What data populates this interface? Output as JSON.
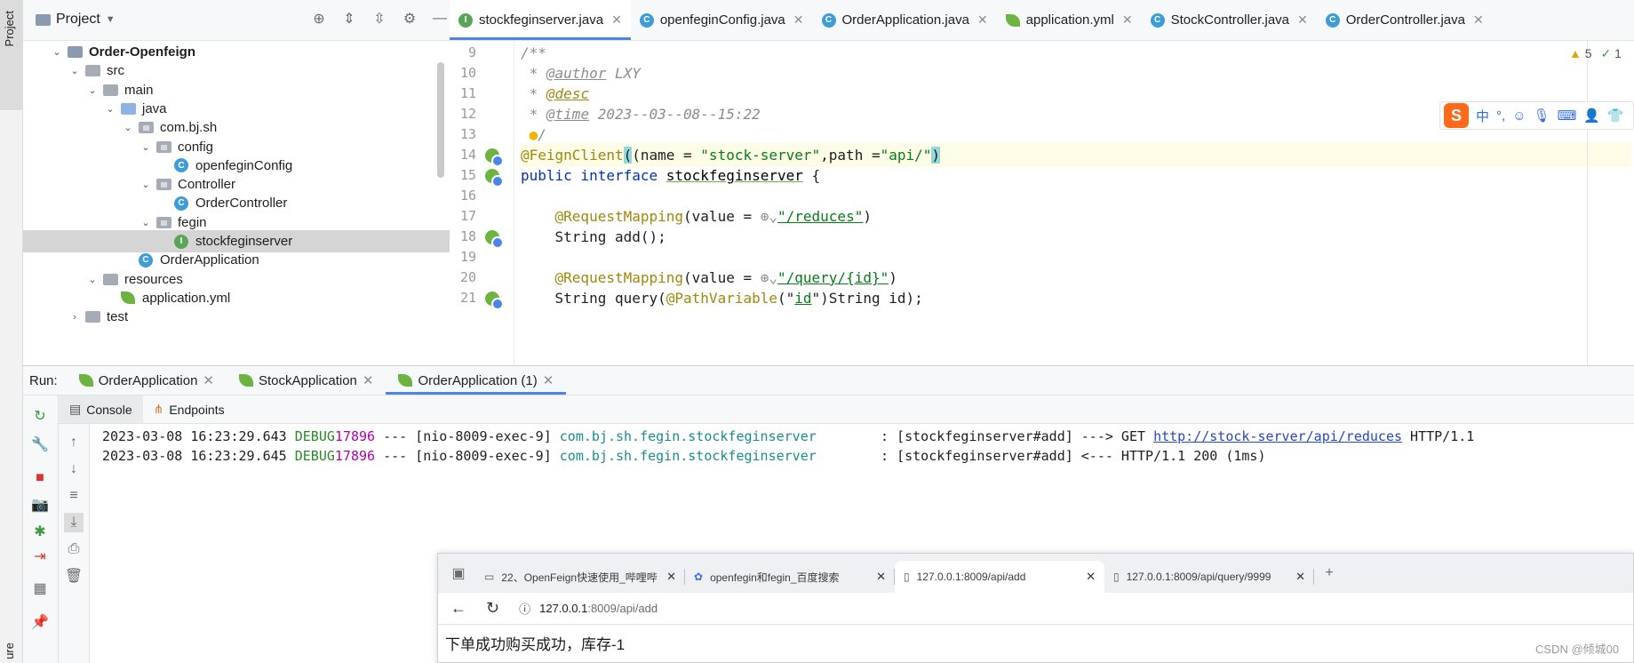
{
  "left_strip": {
    "project_tab": "Project",
    "structure_tab": "ure"
  },
  "project_panel": {
    "title": "Project"
  },
  "project_tree": [
    {
      "label": "Order-Openfeign",
      "kind": "module",
      "bold": true
    },
    {
      "label": "src",
      "kind": "folder"
    },
    {
      "label": "main",
      "kind": "folder"
    },
    {
      "label": "java",
      "kind": "folder-blue"
    },
    {
      "label": "com.bj.sh",
      "kind": "package"
    },
    {
      "label": "config",
      "kind": "package"
    },
    {
      "label": "openfeginConfig",
      "kind": "class"
    },
    {
      "label": "Controller",
      "kind": "package"
    },
    {
      "label": "OrderController",
      "kind": "class"
    },
    {
      "label": "fegin",
      "kind": "package"
    },
    {
      "label": "stockfeginserver",
      "kind": "interface",
      "selected": true
    },
    {
      "label": "OrderApplication",
      "kind": "class"
    },
    {
      "label": "resources",
      "kind": "folder"
    },
    {
      "label": "application.yml",
      "kind": "yml"
    },
    {
      "label": "test",
      "kind": "folder"
    }
  ],
  "editor_tabs": [
    {
      "label": "stockfeginserver.java",
      "icon": "interface-icon",
      "active": true
    },
    {
      "label": "openfeginConfig.java",
      "icon": "class-icon"
    },
    {
      "label": "OrderApplication.java",
      "icon": "spring-class-icon"
    },
    {
      "label": "application.yml",
      "icon": "spring-leaf-icon"
    },
    {
      "label": "StockController.java",
      "icon": "class-icon"
    },
    {
      "label": "OrderController.java",
      "icon": "class-icon"
    }
  ],
  "line_numbers": [
    "9",
    "10",
    "11",
    "12",
    "13",
    "14",
    "15",
    "16",
    "17",
    "18",
    "19",
    "20",
    "21"
  ],
  "code": {
    "l9": "/**",
    "l10_tag": "@author",
    "l10_val": " LXY",
    "l11_tag": "@desc",
    "l12_tag": "@time",
    "l12_val": " 2023--03--08--15:22",
    "l13": "/",
    "l14_ann": "@FeignClient",
    "l14_a": "(name = ",
    "l14_s1": "\"stock-server\"",
    "l14_b": ",path =",
    "l14_s2": "\"api/\"",
    "l14_c": ")",
    "l15_kw": "public interface ",
    "l15_name": "stockfeginserver",
    "l15_rest": " {",
    "l17_ann": "@RequestMapping",
    "l17_a": "(value = ",
    "l17_s": "\"/reduces\"",
    "l17_c": ")",
    "l18": "String add();",
    "l20_ann": "@RequestMapping",
    "l20_a": "(value = ",
    "l20_s": "\"/query/{id}\"",
    "l20_c": ")",
    "l21_a": "String query(",
    "l21_ann": "@PathVariable",
    "l21_b": "(\"",
    "l21_s": "id",
    "l21_c": "\")String id);"
  },
  "inspections": {
    "warnings": "5",
    "ok": "1"
  },
  "ime": {
    "lang": "中"
  },
  "run": {
    "label": "Run:",
    "tabs": [
      {
        "label": "OrderApplication"
      },
      {
        "label": "StockApplication"
      },
      {
        "label": "OrderApplication (1)",
        "active": true
      }
    ],
    "console_tabs": [
      {
        "label": "Console",
        "active": true
      },
      {
        "label": "Endpoints"
      }
    ]
  },
  "log": [
    {
      "ts": "2023-03-08 16:23:29.643 ",
      "level": "DEBUG",
      "pid": "17896",
      "thread": " --- [nio-8009-exec-9] ",
      "logger": "com.bj.sh.fegin.stockfeginserver",
      "msg_a": "        : [stockfeginserver#add] ---> GET ",
      "url": "http://stock-server/api/reduces",
      "msg_b": " HTTP/1.1"
    },
    {
      "ts": "2023-03-08 16:23:29.645 ",
      "level": "DEBUG",
      "pid": "17896",
      "thread": " --- [nio-8009-exec-9] ",
      "logger": "com.bj.sh.fegin.stockfeginserver",
      "msg_a": "        : [stockfeginserver#add] <--- HTTP/1.1 200 (1ms)",
      "url": "",
      "msg_b": ""
    }
  ],
  "browser": {
    "tabs": [
      {
        "label": "22、OpenFeign快速使用_哔哩哔"
      },
      {
        "label": "openfegin和fegin_百度搜索"
      },
      {
        "label": "127.0.0.1:8009/api/add",
        "active": true
      },
      {
        "label": "127.0.0.1:8009/api/query/9999"
      }
    ],
    "address_host": "127.0.0.1",
    "address_path": ":8009/api/add",
    "content": "下单成功购买成功，库存-1"
  },
  "watermark": "CSDN @倾城00"
}
